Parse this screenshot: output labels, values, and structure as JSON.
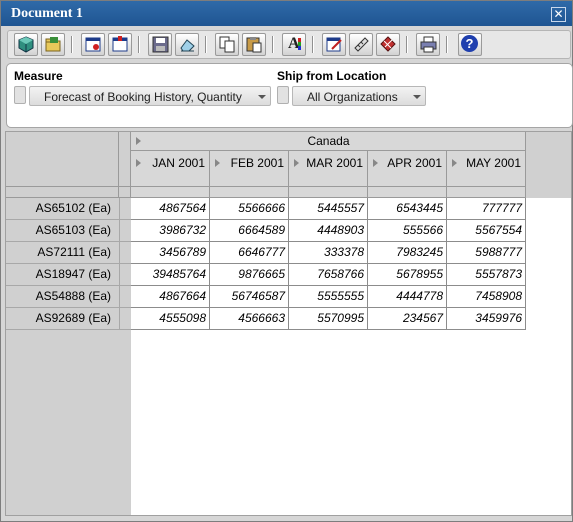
{
  "window": {
    "title": "Document 1",
    "close_glyph": "✕"
  },
  "toolbar": {
    "buttons": [
      {
        "icon": "cube-icon"
      },
      {
        "icon": "open-folder-icon"
      },
      {
        "icon": "report-icon"
      },
      {
        "icon": "calendar-icon"
      },
      {
        "icon": "save-icon"
      },
      {
        "icon": "eraser-icon"
      },
      {
        "icon": "copy-icon"
      },
      {
        "icon": "paste-icon"
      },
      {
        "icon": "font-icon"
      },
      {
        "icon": "edit-form-icon"
      },
      {
        "icon": "ruler-icon"
      },
      {
        "icon": "grid-icon"
      },
      {
        "icon": "print-icon"
      },
      {
        "icon": "help-icon"
      }
    ],
    "font_glyph": "A",
    "help_glyph": "?"
  },
  "parameters": {
    "measure": {
      "label": "Measure",
      "value": "Forecast of Booking History, Quantity"
    },
    "ship_from": {
      "label": "Ship from Location",
      "value": "All Organizations"
    }
  },
  "grid": {
    "group_header": "Canada",
    "columns": [
      "JAN 2001",
      "FEB 2001",
      "MAR 2001",
      "APR 2001",
      "MAY 2001"
    ],
    "rows": [
      {
        "label": "AS65102 (Ea)",
        "values": [
          "4867564",
          "5566666",
          "5445557",
          "6543445",
          "777777"
        ]
      },
      {
        "label": "AS65103 (Ea)",
        "values": [
          "3986732",
          "6664589",
          "4448903",
          "555566",
          "5567554"
        ]
      },
      {
        "label": "AS72111 (Ea)",
        "values": [
          "3456789",
          "6646777",
          "333378",
          "7983245",
          "5988777"
        ]
      },
      {
        "label": "AS18947 (Ea)",
        "values": [
          "39485764",
          "9876665",
          "7658766",
          "5678955",
          "5557873"
        ]
      },
      {
        "label": "AS54888 (Ea)",
        "values": [
          "4867664",
          "56746587",
          "5555555",
          "4444778",
          "7458908"
        ]
      },
      {
        "label": "AS92689 (Ea)",
        "values": [
          "4555098",
          "4566663",
          "5570995",
          "234567",
          "3459976"
        ]
      }
    ]
  }
}
